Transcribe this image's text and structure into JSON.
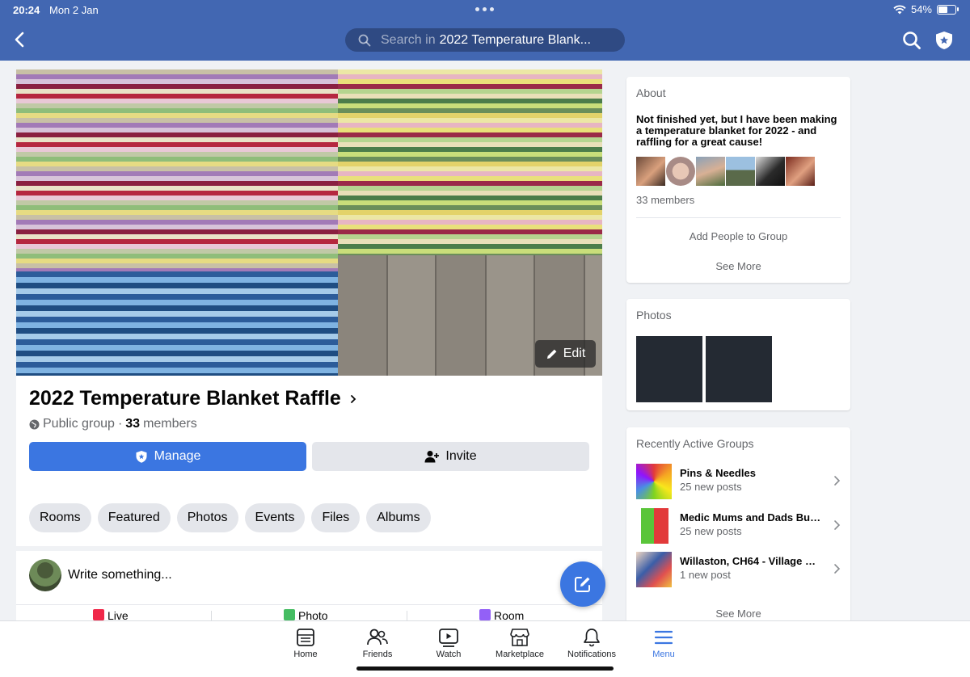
{
  "status_bar": {
    "time": "20:24",
    "date": "Mon 2 Jan",
    "battery": "54%"
  },
  "header": {
    "search_prefix": "Search in",
    "search_value": "2022 Temperature Blank..."
  },
  "group": {
    "title": "2022 Temperature Blanket Raffle",
    "privacy": "Public group",
    "separator": "·",
    "member_count": "33",
    "members_word": "members",
    "edit_label": "Edit",
    "manage_label": "Manage",
    "invite_label": "Invite",
    "tabs": [
      "Rooms",
      "Featured",
      "Photos",
      "Events",
      "Files",
      "Albums"
    ],
    "composer_placeholder": "Write something...",
    "actions": [
      "Live",
      "Photo",
      "Room"
    ]
  },
  "about": {
    "title": "About",
    "description": "Not finished yet, but I have been making a temperature blanket for 2022 - and raffling for a great cause!",
    "members_text": "33 members",
    "add_people": "Add People to Group",
    "see_more": "See More"
  },
  "photos": {
    "title": "Photos"
  },
  "recent_groups": {
    "title": "Recently Active Groups",
    "items": [
      {
        "name": "Pins & Needles",
        "meta": "25 new posts"
      },
      {
        "name": "Medic Mums and Dads Buy,...",
        "meta": "25 new posts"
      },
      {
        "name": "Willaston, CH64 - Village Co...",
        "meta": "1 new post"
      }
    ],
    "see_more": "See More"
  },
  "bottom_nav": [
    {
      "label": "Home",
      "icon": "home-icon"
    },
    {
      "label": "Friends",
      "icon": "friends-icon"
    },
    {
      "label": "Watch",
      "icon": "watch-icon"
    },
    {
      "label": "Marketplace",
      "icon": "marketplace-icon"
    },
    {
      "label": "Notifications",
      "icon": "bell-icon"
    },
    {
      "label": "Menu",
      "icon": "menu-icon"
    }
  ],
  "colors": {
    "header": "#4267b2",
    "accent": "#3b76e1",
    "background": "#f0f2f5"
  }
}
